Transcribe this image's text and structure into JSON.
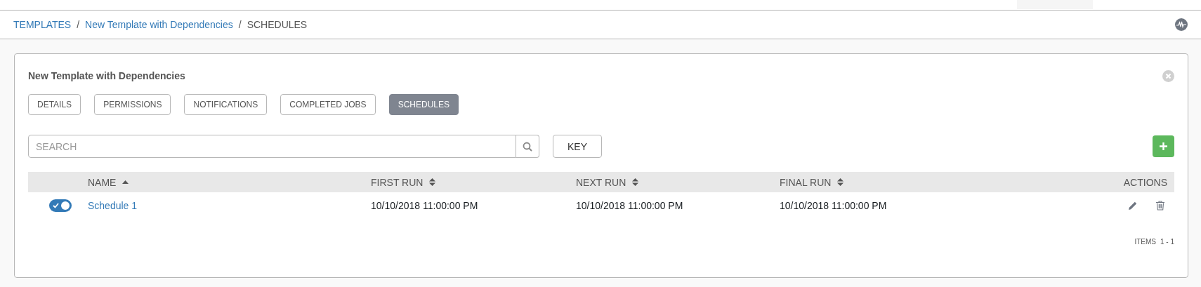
{
  "breadcrumb": [
    {
      "kind": "link",
      "label": "TEMPLATES"
    },
    {
      "kind": "separator",
      "label": "/"
    },
    {
      "kind": "link",
      "label": "New Template with Dependencies"
    },
    {
      "kind": "separator",
      "label": "/"
    },
    {
      "kind": "current",
      "label": "SCHEDULES"
    }
  ],
  "card": {
    "title": "New Template with Dependencies",
    "tabs": [
      {
        "label": "DETAILS",
        "selected": false
      },
      {
        "label": "PERMISSIONS",
        "selected": false
      },
      {
        "label": "NOTIFICATIONS",
        "selected": false
      },
      {
        "label": "COMPLETED JOBS",
        "selected": false
      },
      {
        "label": "SCHEDULES",
        "selected": true
      }
    ],
    "search": {
      "placeholder": "SEARCH"
    },
    "key_button": "KEY",
    "table": {
      "columns": [
        {
          "label": "NAME",
          "kind": "sorted"
        },
        {
          "label": "FIRST RUN",
          "kind": "sortable"
        },
        {
          "label": "NEXT RUN",
          "kind": "sortable"
        },
        {
          "label": "FINAL RUN",
          "kind": "sortable"
        },
        {
          "label": "ACTIONS",
          "kind": "plain"
        }
      ],
      "rows": [
        {
          "on": true,
          "name": "Schedule 1",
          "first_run": "10/10/2018 11:00:00 PM",
          "next_run": "10/10/2018 11:00:00 PM",
          "final_run": "10/10/2018 11:00:00 PM"
        }
      ]
    },
    "items_label": "ITEMS",
    "items_range": "1 - 1"
  }
}
